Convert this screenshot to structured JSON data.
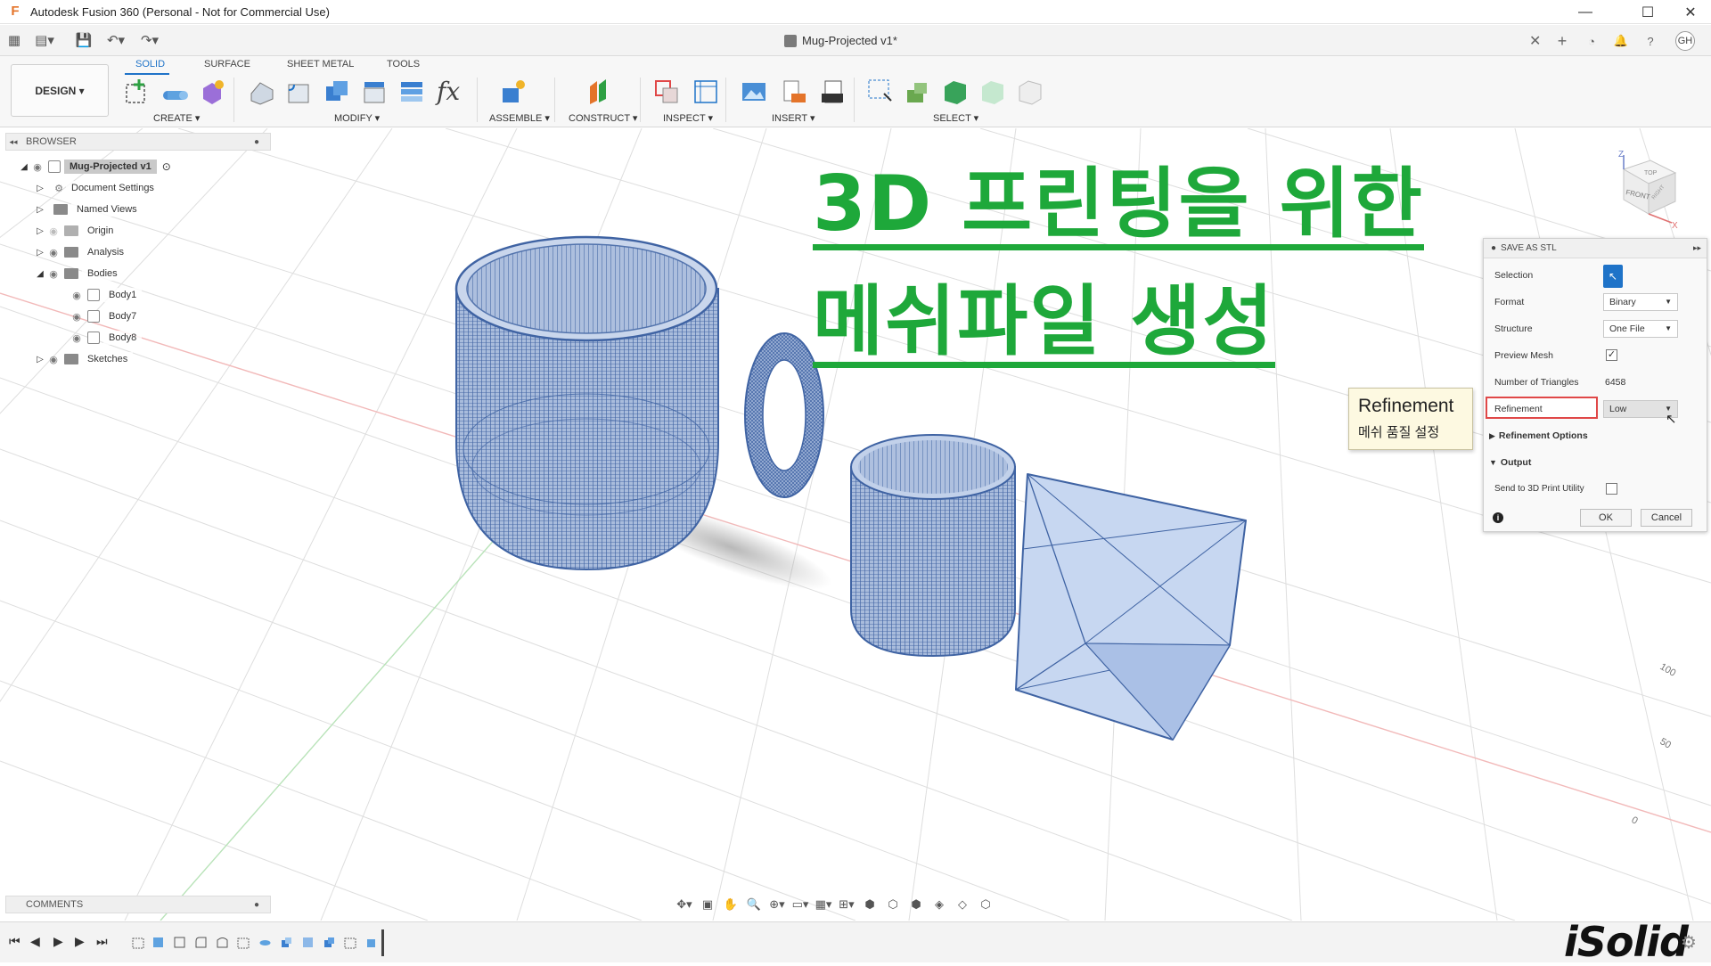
{
  "app": {
    "title": "Autodesk Fusion 360 (Personal - Not for Commercial Use)",
    "document_tab": "Mug-Projected v1*"
  },
  "quickbar": {
    "avatar_initials": "GH"
  },
  "ribbon": {
    "workspace": "DESIGN ▾",
    "tabs": [
      "SOLID",
      "SURFACE",
      "SHEET METAL",
      "TOOLS"
    ],
    "groups": [
      "CREATE ▾",
      "MODIFY ▾",
      "ASSEMBLE ▾",
      "CONSTRUCT ▾",
      "INSPECT ▾",
      "INSERT ▾",
      "SELECT ▾"
    ],
    "fx": "fx"
  },
  "browser": {
    "title": "BROWSER",
    "root": "Mug-Projected v1",
    "items": [
      "Document Settings",
      "Named Views",
      "Origin",
      "Analysis",
      "Bodies",
      "Body1",
      "Body7",
      "Body8",
      "Sketches"
    ]
  },
  "heading": {
    "line1": "3D 프린팅을 위한",
    "line2": "메쉬파일 생성"
  },
  "stl_panel": {
    "title": "SAVE AS STL",
    "selection_label": "Selection",
    "format_label": "Format",
    "format_value": "Binary",
    "structure_label": "Structure",
    "structure_value": "One File",
    "preview_label": "Preview Mesh",
    "preview_checked": "✓",
    "triangles_label": "Number of Triangles",
    "triangles_value": "6458",
    "refinement_label": "Refinement",
    "refinement_value": "Low",
    "refinement_options": "Refinement Options",
    "output": "Output",
    "send_label": "Send to 3D Print Utility",
    "ok": "OK",
    "cancel": "Cancel"
  },
  "tooltip": {
    "title": "Refinement",
    "subtitle": "메쉬 품질 설정"
  },
  "viewcube": {
    "top": "TOP",
    "front": "FRONT",
    "right": "RIGHT",
    "z": "Z",
    "x": "X"
  },
  "grid_labels": [
    "100",
    "50",
    "0"
  ],
  "comments": "COMMENTS",
  "brand": "iSolid",
  "colors": {
    "accent": "#1f73c8",
    "heading_green": "#1ea83a",
    "mesh_blue": "#3f63a3",
    "highlight_red": "#e04848"
  }
}
